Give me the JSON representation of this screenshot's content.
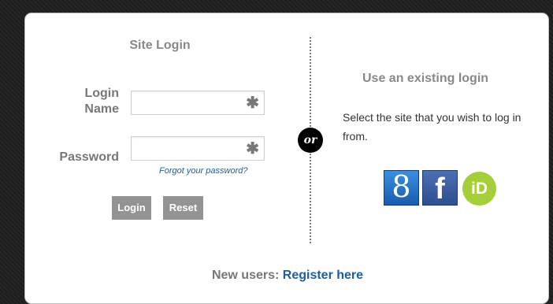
{
  "site_login": {
    "title": "Site Login",
    "login_name_label_line1": "Login",
    "login_name_label_line2": "Name",
    "login_name_value": "",
    "password_label": "Password",
    "password_value": "",
    "required_marker": "✱",
    "forgot_password": "Forgot your password?",
    "login_button": "Login",
    "reset_button": "Reset"
  },
  "separator": {
    "label": "or"
  },
  "existing_login": {
    "title": "Use an existing login",
    "description": "Select the site that you wish to log in from.",
    "providers": [
      {
        "icon": "google-icon",
        "glyph": "8",
        "color": "#2a74c9"
      },
      {
        "icon": "facebook-icon",
        "glyph": "f",
        "color": "#3b5998"
      },
      {
        "icon": "orcid-icon",
        "glyph": "iD",
        "color": "#a6ce39"
      }
    ]
  },
  "footer": {
    "prefix": "New users:",
    "register_link": "Register here"
  },
  "colors": {
    "link": "#1a5ea8",
    "button": "#939393",
    "background": "#222222"
  }
}
